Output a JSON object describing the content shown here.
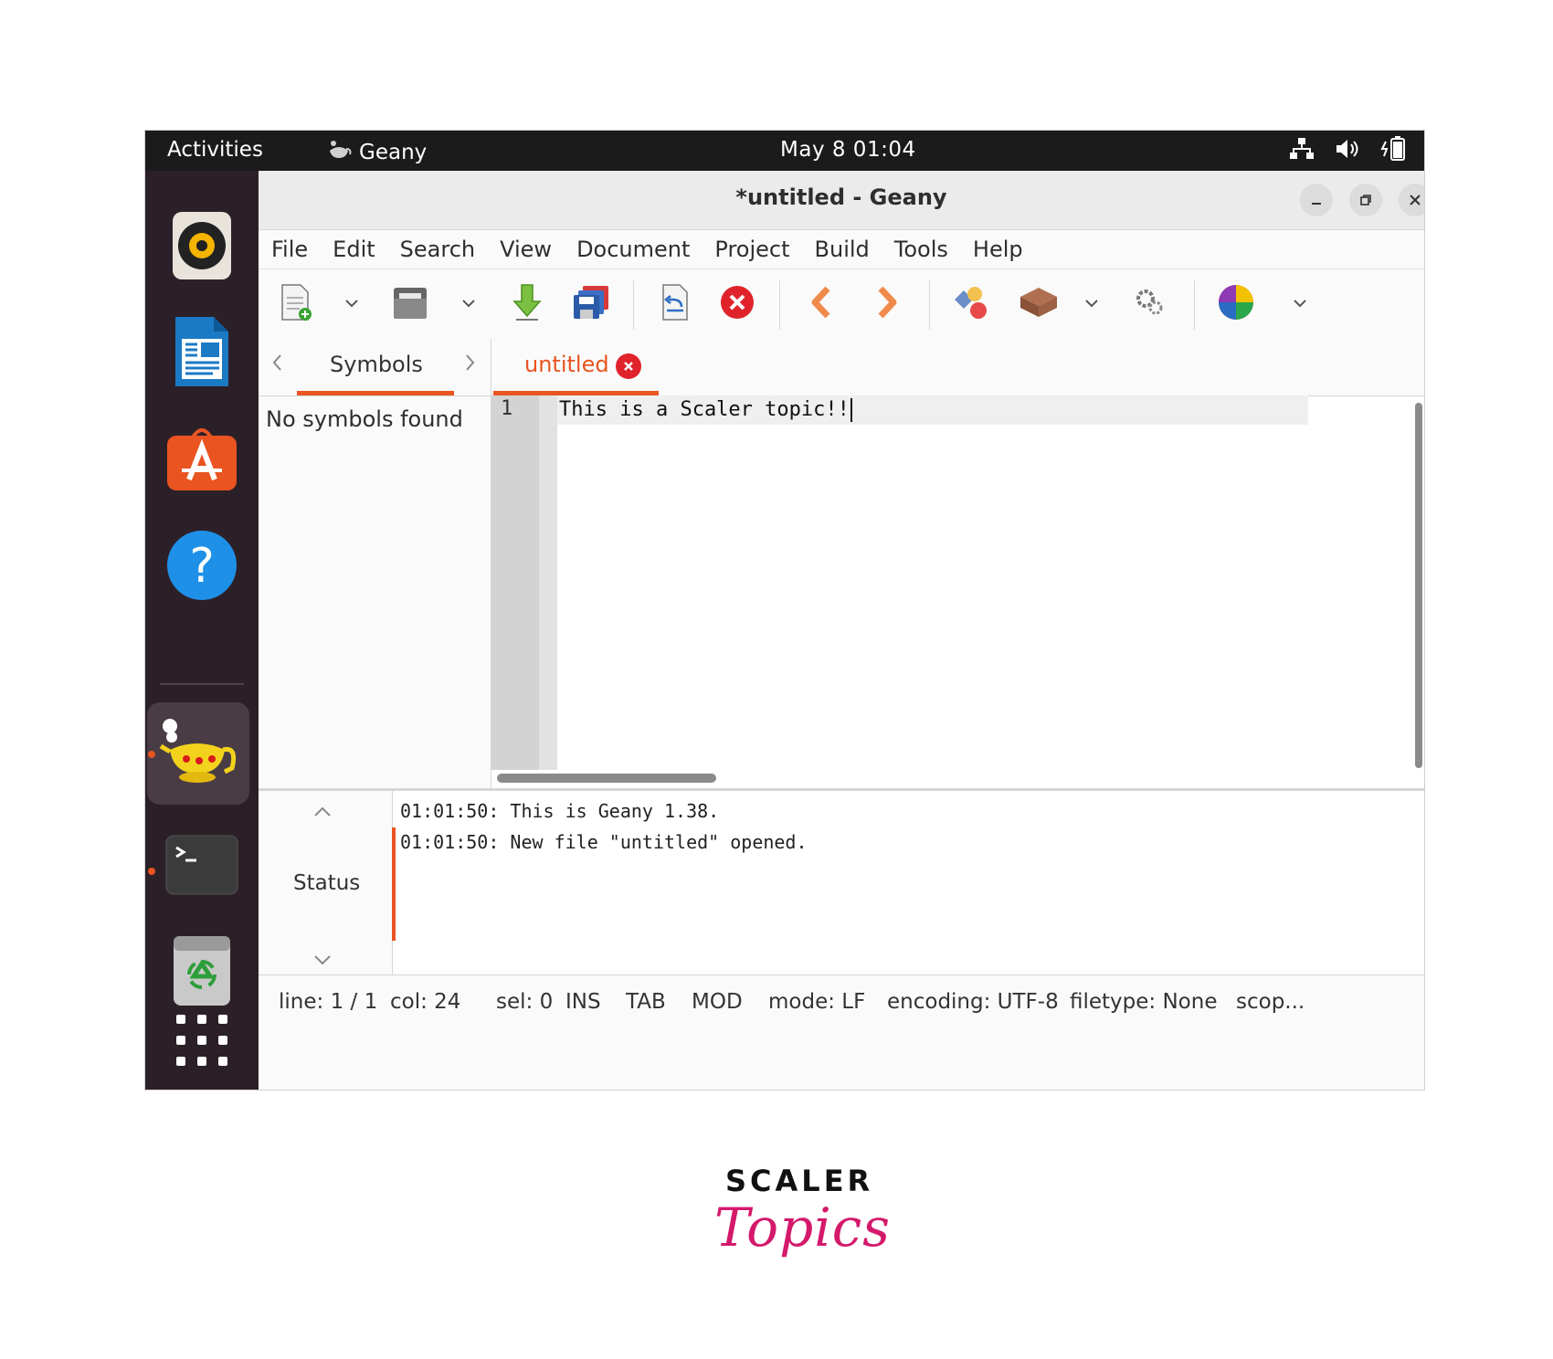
{
  "topbar": {
    "activities": "Activities",
    "app_name": "Geany",
    "clock": "May 8  01:04"
  },
  "window": {
    "title": "*untitled - Geany"
  },
  "menu": [
    "File",
    "Edit",
    "Search",
    "View",
    "Document",
    "Project",
    "Build",
    "Tools",
    "Help"
  ],
  "sidebar": {
    "tab_label": "Symbols",
    "empty_text": "No symbols found"
  },
  "editor": {
    "tab_label": "untitled",
    "line_number": "1",
    "code_line": "This is a Scaler topic!!"
  },
  "messages": {
    "panel_label": "Status",
    "lines": [
      "01:01:50: This is Geany 1.38.",
      "01:01:50: New file \"untitled\" opened."
    ]
  },
  "statusbar": {
    "line": "line: 1 / 1",
    "col": "col: 24",
    "sel": "sel: 0",
    "ins": "INS",
    "tab": "TAB",
    "mod": "MOD",
    "mode": "mode: LF",
    "encoding": "encoding: UTF-8",
    "filetype": "filetype: None",
    "scope": "scop..."
  },
  "brand": {
    "line1": "SCALER",
    "line2": "Topics"
  },
  "colors": {
    "accent": "#e95420",
    "close_red": "#e0232b",
    "brand_pink": "#d4196b"
  }
}
